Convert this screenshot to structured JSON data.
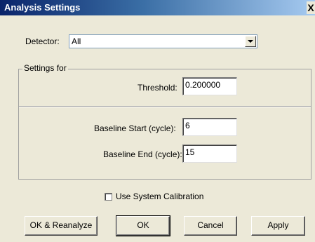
{
  "window": {
    "title": "Analysis Settings",
    "close_glyph": "X"
  },
  "detector": {
    "label": "Detector:",
    "value": "All"
  },
  "settings_group": {
    "caption": "Settings for",
    "threshold": {
      "label": "Threshold:",
      "value": "0.200000"
    },
    "baseline_start": {
      "label": "Baseline Start (cycle):",
      "value": "6"
    },
    "baseline_end": {
      "label": "Baseline End (cycle):",
      "value": "15"
    }
  },
  "calibration": {
    "label": "Use System Calibration",
    "checked": false
  },
  "buttons": {
    "ok_reanalyze": "OK & Reanalyze",
    "ok": "OK",
    "cancel": "Cancel",
    "apply": "Apply"
  },
  "colors": {
    "titlebar_start": "#0a246a",
    "titlebar_end": "#a6caf0",
    "dialog_bg": "#ece9d8"
  }
}
